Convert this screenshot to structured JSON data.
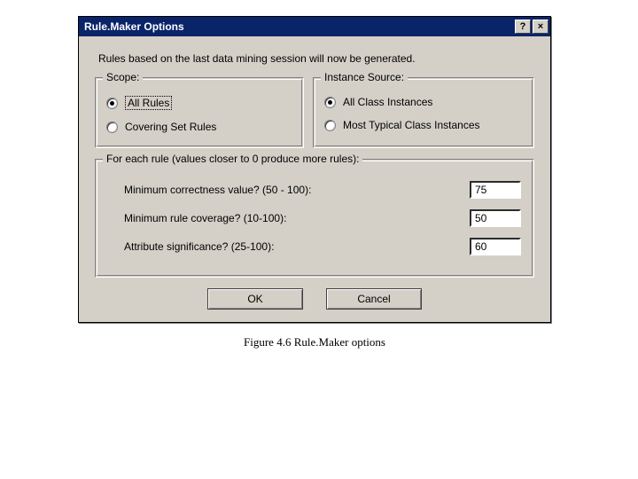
{
  "window": {
    "title": "Rule.Maker Options",
    "help_glyph": "?",
    "close_glyph": "×"
  },
  "intro": "Rules based on the last data mining session will now be generated.",
  "scope": {
    "legend": "Scope:",
    "options": {
      "all": "All Rules",
      "covering": "Covering Set Rules"
    },
    "selected": "all"
  },
  "instance": {
    "legend": "Instance Source:",
    "options": {
      "all": "All Class Instances",
      "typical": "Most Typical Class Instances"
    },
    "selected": "all"
  },
  "params": {
    "legend": "For each rule (values closer to 0 produce more rules):",
    "rows": {
      "correctness": {
        "label": "Minimum correctness value? (50 - 100):",
        "value": "75"
      },
      "coverage": {
        "label": "Minimum rule coverage? (10-100):",
        "value": "50"
      },
      "attrsig": {
        "label": "Attribute significance? (25-100):",
        "value": "60"
      }
    }
  },
  "buttons": {
    "ok": "OK",
    "cancel": "Cancel"
  },
  "caption": "Figure 4.6 Rule.Maker options"
}
